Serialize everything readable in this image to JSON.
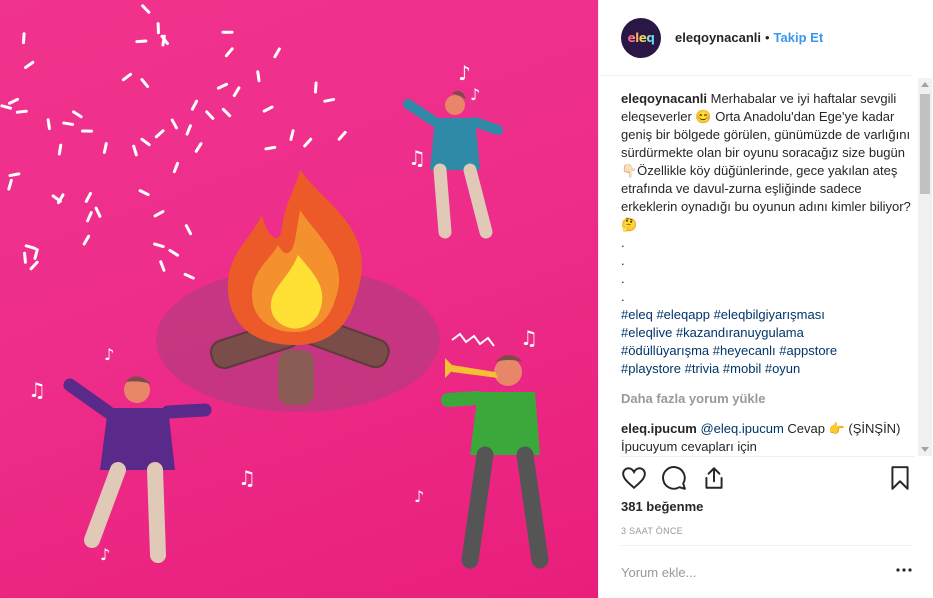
{
  "post": {
    "avatar_text": "eleq",
    "username": "eleqoynacanli",
    "dot": "•",
    "follow_label": "Takip Et"
  },
  "caption": {
    "user": "eleqoynacanli",
    "text": "Merhabalar ve iyi haftalar sevgili eleqseverler 😊 Orta Anadolu'dan Ege'ye kadar geniş bir bölgede görülen, günümüzde de varlığını sürdürmekte olan bir oyunu soracağız size bugün👇🏻Özellikle köy düğünlerinde, gece yakılan ateş etrafında ve davul-zurna eşliğinde sadece erkeklerin oynadığı bu oyunun adını kimler biliyor? 🤔\n.\n.\n.\n.",
    "hashtags": [
      "#eleq",
      "#eleqapp",
      "#eleqbilgiyarışması",
      "#eleqlive",
      "#kazandıranuygulama",
      "#ödüllüyarışma",
      "#heyecanlı",
      "#appstore",
      "#playstore",
      "#trivia",
      "#mobil",
      "#oyun"
    ]
  },
  "load_more_label": "Daha fazla yorum yükle",
  "comment": {
    "user": "eleq.ipucum",
    "mention": "@eleq.ipucum",
    "text": "Cevap 👉 (ŞİNŞİN) İpucuyum cevapları için"
  },
  "likes_text": "381 beğenme",
  "time_text": "3 SAAT ÖNCE",
  "add_comment_placeholder": "Yorum ekle...",
  "icons": {
    "like": "heart-icon",
    "comment": "comment-icon",
    "share": "share-icon",
    "save": "bookmark-icon",
    "more": "more-icon"
  },
  "colors": {
    "image_bg": "#ee2d8a",
    "link": "#3897f0",
    "hashtag": "#003569",
    "muted": "#999999"
  }
}
